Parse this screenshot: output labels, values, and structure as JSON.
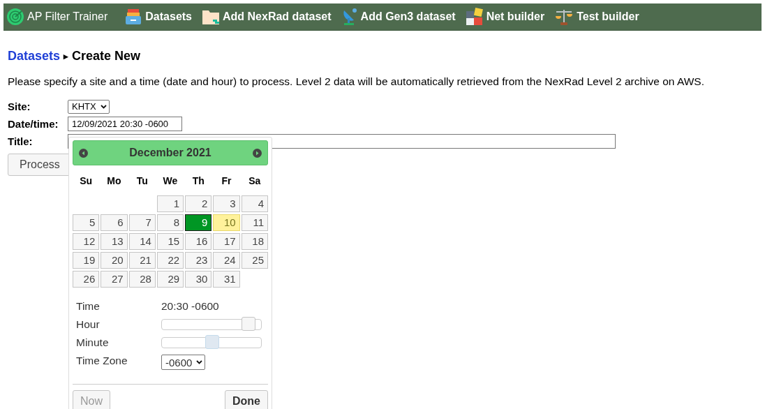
{
  "navbar": {
    "brand": "AP Filter Trainer",
    "items": [
      {
        "label": "Datasets"
      },
      {
        "label": "Add NexRad dataset"
      },
      {
        "label": "Add Gen3 dataset"
      },
      {
        "label": "Net builder"
      },
      {
        "label": "Test builder"
      }
    ]
  },
  "breadcrumb": {
    "link": "Datasets",
    "separator": "▸",
    "current": "Create New"
  },
  "intro": "Please specify a site and a time (date and hour) to process. Level 2 data will be automatically retrieved from the NexRad Level 2 archive on AWS.",
  "form": {
    "site": {
      "label": "Site:",
      "value": "KHTX"
    },
    "datetime": {
      "label": "Date/time:",
      "value": "12/09/2021 20:30 -0600"
    },
    "title": {
      "label": "Title:"
    },
    "submit": "Process"
  },
  "datepicker": {
    "month": "December 2021",
    "weekdays": [
      "Su",
      "Mo",
      "Tu",
      "We",
      "Th",
      "Fr",
      "Sa"
    ],
    "weeks": [
      {
        "days": [
          {
            "kind": "blank"
          },
          {
            "kind": "blank"
          },
          {
            "kind": "blank"
          },
          {
            "label": "1",
            "selected": false,
            "today": false
          },
          {
            "label": "2",
            "selected": false,
            "today": false
          },
          {
            "label": "3",
            "selected": false,
            "today": false
          },
          {
            "label": "4",
            "selected": false,
            "today": false
          }
        ]
      },
      {
        "days": [
          {
            "label": "5",
            "selected": false,
            "today": false
          },
          {
            "label": "6",
            "selected": false,
            "today": false
          },
          {
            "label": "7",
            "selected": false,
            "today": false
          },
          {
            "label": "8",
            "selected": false,
            "today": false
          },
          {
            "label": "9",
            "selected": true,
            "today": false
          },
          {
            "label": "10",
            "selected": false,
            "today": true
          },
          {
            "label": "11",
            "selected": false,
            "today": false
          }
        ]
      },
      {
        "days": [
          {
            "label": "12",
            "selected": false,
            "today": false
          },
          {
            "label": "13",
            "selected": false,
            "today": false
          },
          {
            "label": "14",
            "selected": false,
            "today": false
          },
          {
            "label": "15",
            "selected": false,
            "today": false
          },
          {
            "label": "16",
            "selected": false,
            "today": false
          },
          {
            "label": "17",
            "selected": false,
            "today": false
          },
          {
            "label": "18",
            "selected": false,
            "today": false
          }
        ]
      },
      {
        "days": [
          {
            "label": "19",
            "selected": false,
            "today": false
          },
          {
            "label": "20",
            "selected": false,
            "today": false
          },
          {
            "label": "21",
            "selected": false,
            "today": false
          },
          {
            "label": "22",
            "selected": false,
            "today": false
          },
          {
            "label": "23",
            "selected": false,
            "today": false
          },
          {
            "label": "24",
            "selected": false,
            "today": false
          },
          {
            "label": "25",
            "selected": false,
            "today": false
          }
        ]
      },
      {
        "days": [
          {
            "label": "26",
            "selected": false,
            "today": false
          },
          {
            "label": "27",
            "selected": false,
            "today": false
          },
          {
            "label": "28",
            "selected": false,
            "today": false
          },
          {
            "label": "29",
            "selected": false,
            "today": false
          },
          {
            "label": "30",
            "selected": false,
            "today": false
          },
          {
            "label": "31",
            "selected": false,
            "today": false
          }
        ]
      }
    ],
    "time": {
      "label": "Time",
      "value": "20:30 -0600"
    },
    "sliders": [
      {
        "label": "Hour",
        "level": 0.87,
        "active": false
      },
      {
        "label": "Minute",
        "level": 0.51,
        "active": true
      }
    ],
    "timezone": {
      "label": "Time Zone",
      "value": "-0600"
    },
    "buttons": [
      {
        "label": "Now",
        "disabled": true
      },
      {
        "label": "Done",
        "disabled": false
      }
    ]
  }
}
